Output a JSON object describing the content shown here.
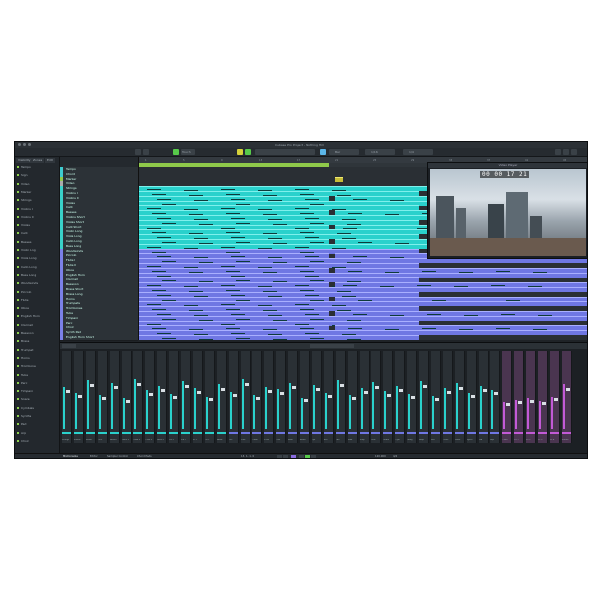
{
  "window": {
    "title": "Cubase Pro Project - Nothing Hill"
  },
  "toolbar": {
    "touch_mode": "Touch",
    "quantize": "1/16",
    "grid": "Bar",
    "snap": "1/4"
  },
  "left_zone": {
    "tabs": [
      "Visibility",
      "Zones",
      "Edit"
    ],
    "tracks": [
      "Tempo",
      "Sign",
      "Video",
      "Marker",
      "Strings",
      "Violins I",
      "Violins II",
      "Violas",
      "Celli",
      "Basses",
      "Violin Lng",
      "Viola Long",
      "Cello Long",
      "Bass Long",
      "Woodwinds",
      "Piccolo",
      "Flute",
      "Oboe",
      "English Horn",
      "Clarinet",
      "Bassoon",
      "Brass",
      "Trumpet",
      "Horns",
      "Trombone",
      "Tuba",
      "Perc",
      "Timpani",
      "Snare",
      "Cymbals",
      "Synths",
      "Pad",
      "Arp",
      "Choir"
    ]
  },
  "track_header": {
    "rows": [
      "Tempo",
      "Chord",
      "Marker",
      "Video",
      "Strings",
      "Violins I",
      "Violins II",
      "Violas",
      "Celli",
      "Basses",
      "Violins Short",
      "Violas Short",
      "Celli Short",
      "Violin Long",
      "Viola Long",
      "Cello Long",
      "Bass Long",
      "Woodwinds",
      "Piccolo",
      "Flute I",
      "Flute II",
      "Oboe",
      "English Horn",
      "Clarinet",
      "Bassoon",
      "Brass Short",
      "Brass Long",
      "Horns",
      "Trumpets",
      "Trombones",
      "Tuba",
      "Timpani",
      "Perc",
      "Choir",
      "Synth Pad",
      "English Horn Short"
    ]
  },
  "ruler": {
    "marks": [
      "1",
      "5",
      "9",
      "13",
      "17",
      "21",
      "25",
      "29",
      "33",
      "37",
      "41",
      "45"
    ]
  },
  "video": {
    "title": "Video Player",
    "timecode": "00 00 17 21"
  },
  "mixer": {
    "tabs": [
      "MixConsole",
      "Editor",
      "Sampler Control",
      "Chord Pads"
    ],
    "channels": [
      "Strings",
      "Violins",
      "Violas",
      "Celli",
      "Basses",
      "Violin S",
      "Viola S",
      "Cello S",
      "Bass S",
      "Vln L",
      "Vla L",
      "Vc L",
      "Cb L",
      "Wood",
      "Picc",
      "Flute",
      "Oboe",
      "E.Hn",
      "Clar",
      "Bssn",
      "Brass",
      "Tpt",
      "Hrn",
      "Tbn",
      "Tuba",
      "Timp",
      "Perc",
      "Snare",
      "Cym",
      "Gong",
      "Harp",
      "Pno",
      "Celes",
      "Glock",
      "Synth",
      "Pad",
      "Arp",
      "Choir",
      "FX 1",
      "FX 2",
      "FX 3",
      "FX 4",
      "Stereo"
    ]
  },
  "transport": {
    "position": "13. 1. 1. 0",
    "tempo": "120.000",
    "signature": "4/4"
  },
  "colors": {
    "teal": "#2ad1cc",
    "purple": "#6f77e3",
    "cycle": "#8fc94a",
    "play": "#57c94a"
  }
}
